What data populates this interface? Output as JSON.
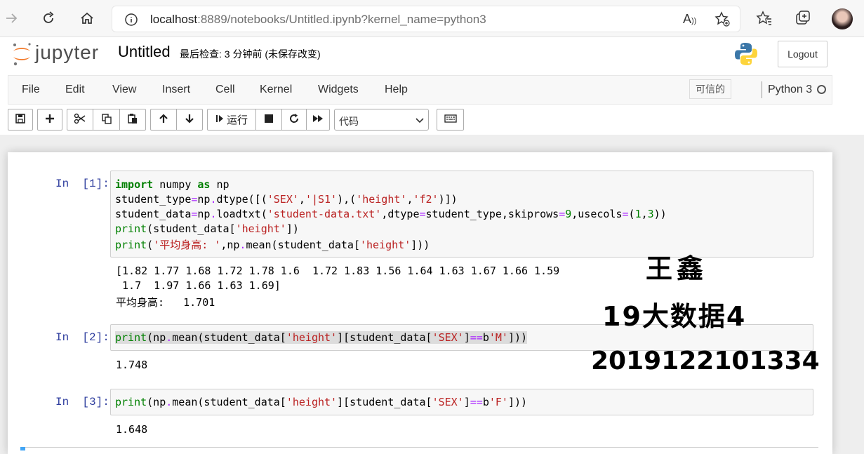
{
  "browser": {
    "url_host": "localhost",
    "url_rest": ":8889/notebooks/Untitled.ipynb?kernel_name=python3"
  },
  "header": {
    "logo_text": "jupyter",
    "notebook_title": "Untitled",
    "checkpoint": "最后检查: 3 分钟前   (未保存改变)",
    "logout": "Logout"
  },
  "menu": {
    "items": [
      "File",
      "Edit",
      "View",
      "Insert",
      "Cell",
      "Kernel",
      "Widgets",
      "Help"
    ],
    "trusted": "可信的",
    "kernel": "Python 3"
  },
  "toolbar": {
    "run_label": "运行",
    "cell_type": "代码"
  },
  "cells": [
    {
      "prompt": "In  [1]:",
      "code": [
        "import numpy as np",
        "student_type=np.dtype([('SEX','|S1'),('height','f2')])",
        "student_data=np.loadtxt('student-data.txt',dtype=student_type,skiprows=9,usecols=(1,3))",
        "print(student_data['height'])",
        "print('平均身高: ',np.mean(student_data['height']))"
      ],
      "output": [
        "[1.82 1.77 1.68 1.72 1.78 1.6  1.72 1.83 1.56 1.64 1.63 1.67 1.66 1.59",
        " 1.7  1.97 1.66 1.63 1.69]",
        "平均身高:   1.701"
      ]
    },
    {
      "prompt": "In  [2]:",
      "code": [
        "print(np.mean(student_data['height'][student_data['SEX']==b'M']))"
      ],
      "output": [
        "1.748"
      ]
    },
    {
      "prompt": "In  [3]:",
      "code": [
        "print(np.mean(student_data['height'][student_data['SEX']==b'F']))"
      ],
      "output": [
        "1.648"
      ]
    }
  ],
  "handwriting": {
    "name": "王鑫",
    "class": "19大数据4",
    "student_id": "2019122101334"
  }
}
